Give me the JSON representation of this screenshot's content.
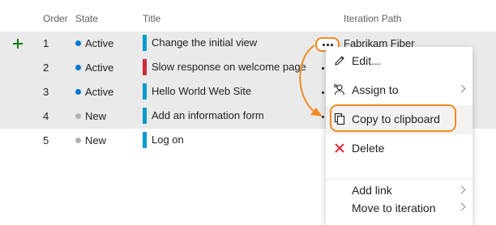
{
  "header": {
    "order": "Order",
    "state": "State",
    "title": "Title",
    "iteration_path": "Iteration Path"
  },
  "rows": [
    {
      "order": "1",
      "state": "Active",
      "state_color": "#0078d4",
      "title": "Change the initial view",
      "type_color": "#009ccc"
    },
    {
      "order": "2",
      "state": "Active",
      "state_color": "#0078d4",
      "title": "Slow response on welcome page",
      "type_color": "#cc293d"
    },
    {
      "order": "3",
      "state": "Active",
      "state_color": "#0078d4",
      "title": "Hello World Web Site",
      "type_color": "#009ccc"
    },
    {
      "order": "4",
      "state": "New",
      "state_color": "#b2b2b2",
      "title": "Add an information form",
      "type_color": "#009ccc"
    },
    {
      "order": "5",
      "state": "New",
      "state_color": "#b2b2b2",
      "title": "Log on",
      "type_color": "#009ccc"
    }
  ],
  "row1_iteration": "Fabrikam Fiber",
  "menu": {
    "items": [
      {
        "label": "Edit...",
        "icon": "pencil-icon",
        "submenu": false
      },
      {
        "label": "Assign to",
        "icon": "person-icon",
        "submenu": true
      },
      {
        "label": "Copy to clipboard",
        "icon": "copy-icon",
        "submenu": false,
        "highlighted": true
      },
      {
        "label": "Delete",
        "icon": "delete-x-icon",
        "submenu": false
      },
      {
        "label": "Add link",
        "icon": "",
        "submenu": true
      },
      {
        "label": "Move to iteration",
        "icon": "",
        "submenu": true
      }
    ]
  },
  "colors": {
    "annotation": "#f08a24",
    "selected_row_bg": "#eaeaea",
    "add_icon": "#107c10",
    "delete_icon": "#e81123"
  }
}
